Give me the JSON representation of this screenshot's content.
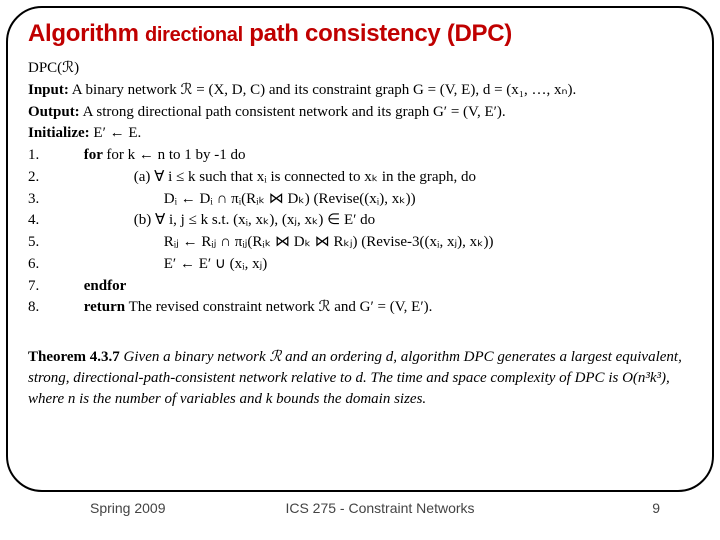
{
  "title": {
    "part1": "Algorithm ",
    "part2": "directional",
    "part3": " path consistency (DPC)"
  },
  "algo": {
    "name": "DPC(ℛ)",
    "input_label": "Input:",
    "input_text": "A binary network ℛ = (X, D, C) and its constraint graph G = (V, E), d = (x₁, …, xₙ).",
    "output_label": "Output:",
    "output_text": "A strong directional path consistent network and its graph G′ = (V, E′).",
    "init_label": "Initialize:",
    "init_text": " E′ ← E.",
    "lines": {
      "l1_num": "1.",
      "l1_body": "for k ← n to 1 by -1 do",
      "l2_num": "2.",
      "l2_body": "(a) ∀ i ≤ k such that xᵢ is connected to xₖ in the graph, do",
      "l3_num": "3.",
      "l3_body": "Dᵢ ← Dᵢ ∩ πᵢ(Rᵢₖ ⋈ Dₖ)  (Revise((xᵢ), xₖ))",
      "l4_num": "4.",
      "l4_body": "(b) ∀ i, j ≤ k s.t.  (xᵢ, xₖ), (xⱼ, xₖ) ∈ E′ do",
      "l5_num": "5.",
      "l5_body": "Rᵢⱼ ← Rᵢⱼ ∩ πᵢⱼ(Rᵢₖ ⋈ Dₖ ⋈ Rₖⱼ)  (Revise-3((xᵢ, xⱼ), xₖ))",
      "l6_num": "6.",
      "l6_body": "E′  ←  E′ ∪ (xᵢ, xⱼ)",
      "l7_num": "7.",
      "l7_body": "endfor",
      "l8_num": "8.",
      "l8_body_label": "return",
      "l8_body_rest": " The revised constraint network ℛ and G′ = (V, E′)."
    }
  },
  "theorem": {
    "label": "Theorem 4.3.7",
    "text": " Given a binary network ℛ and an ordering d, algorithm DPC generates a largest equivalent, strong, directional-path-consistent network relative to d. The time and space complexity of DPC is O(n³k³), where n is the number of variables and k bounds the domain sizes."
  },
  "footer": {
    "left": "Spring 2009",
    "center": "ICS 275 - Constraint Networks",
    "right": "9"
  }
}
